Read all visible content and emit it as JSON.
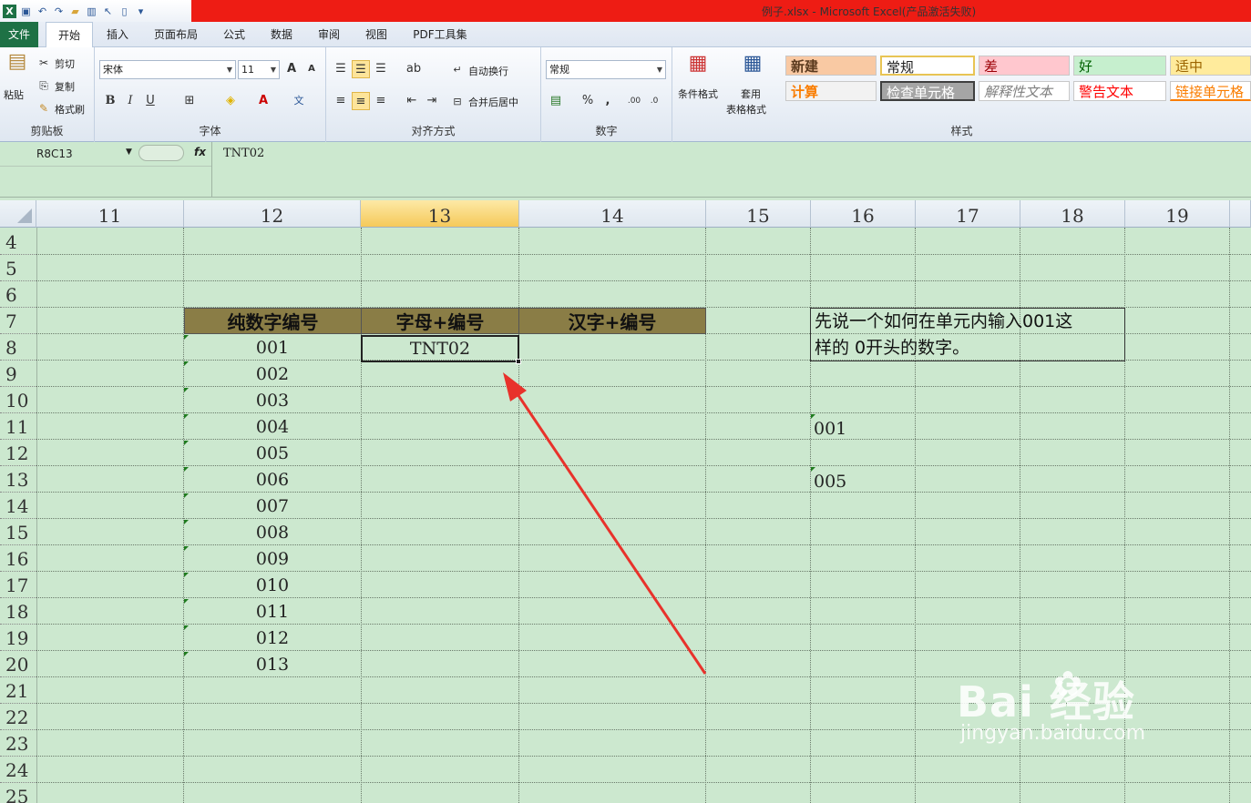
{
  "window": {
    "title": "例子.xlsx - Microsoft Excel(产品激活失败)"
  },
  "ribbon_tabs": [
    "文件",
    "开始",
    "插入",
    "页面布局",
    "公式",
    "数据",
    "审阅",
    "视图",
    "PDF工具集"
  ],
  "clipboard": {
    "paste": "粘贴",
    "cut": "剪切",
    "copy": "复制",
    "format_painter": "格式刷",
    "label": "剪贴板"
  },
  "font": {
    "name": "宋体",
    "size": "11",
    "label": "字体"
  },
  "alignment": {
    "wrap": "自动换行",
    "merge": "合并后居中",
    "label": "对齐方式"
  },
  "number": {
    "format": "常规",
    "label": "数字"
  },
  "styles_group": {
    "cond_format": "条件格式",
    "table_format_1": "套用",
    "table_format_2": "表格格式",
    "label": "样式"
  },
  "styles": [
    {
      "label": "新建",
      "bg": "#f9c9a3",
      "color": "#5b3a1e"
    },
    {
      "label": "常规",
      "bg": "#ffffff",
      "color": "#222222"
    },
    {
      "label": "差",
      "bg": "#ffc7ce",
      "color": "#9c0006"
    },
    {
      "label": "好",
      "bg": "#c6efce",
      "color": "#006100"
    },
    {
      "label": "适中",
      "bg": "#ffeb9c",
      "color": "#9c6500"
    },
    {
      "label": "计算",
      "bg": "#f2f2f2",
      "color": "#fa7d00"
    },
    {
      "label": "检查单元格",
      "bg": "#a5a5a5",
      "color": "#ffffff"
    },
    {
      "label": "解释性文本",
      "bg": "#ffffff",
      "color": "#7f7f7f"
    },
    {
      "label": "警告文本",
      "bg": "#ffffff",
      "color": "#ff0000"
    },
    {
      "label": "链接单元格",
      "bg": "#ffffff",
      "color": "#fa7d00"
    }
  ],
  "formula_bar": {
    "name_box": "R8C13",
    "fx": "fx",
    "value": "TNT02"
  },
  "columns": [
    "11",
    "12",
    "13",
    "14",
    "15",
    "16",
    "17",
    "18",
    "19"
  ],
  "rows": [
    "4",
    "5",
    "6",
    "7",
    "8",
    "9",
    "10",
    "11",
    "12",
    "13",
    "14",
    "15",
    "16",
    "17",
    "18",
    "19",
    "20",
    "21",
    "22",
    "23",
    "24",
    "25"
  ],
  "table_headers": [
    "纯数字编号",
    "字母+编号",
    "汉字+编号"
  ],
  "number_codes": [
    "001",
    "002",
    "003",
    "004",
    "005",
    "006",
    "007",
    "008",
    "009",
    "010",
    "011",
    "012",
    "013"
  ],
  "active_cell_value": "TNT02",
  "note": {
    "line1": "先说一个如何在单元内输入001这",
    "line2": "样的 0开头的数字。"
  },
  "col16_values": {
    "r11": "001",
    "r13": "005"
  },
  "watermark": {
    "logo": "Bai  经验",
    "url": "jingyan.baidu.com"
  },
  "colors": {
    "excel_green": "#1e7145",
    "sheet_bg": "#cce8cf",
    "header_fill": "#8a7d46",
    "arrow": "#e8322b",
    "title_red": "#ee1c14"
  }
}
